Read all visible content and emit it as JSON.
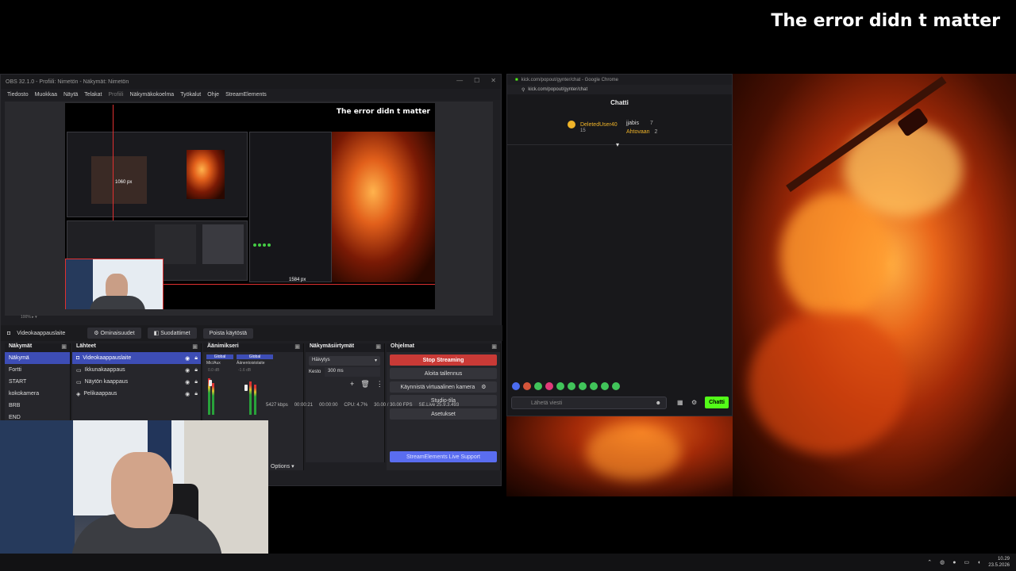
{
  "overlay": {
    "title": "The error didn t matter"
  },
  "obs": {
    "window_title": "OBS 32.1.0 - Profiili: Nimetön - Näkymät: Nimetön",
    "menu": [
      "Tiedosto",
      "Muokkaa",
      "Näytä",
      "Telakat",
      "Profiili",
      "Näkymäkokoelma",
      "Työkalut",
      "Ohje",
      "StreamElements"
    ],
    "preview_title": "The error didn t matter",
    "preview_px_label_1": "1060 px",
    "preview_px_label_2": "1584 px",
    "source_toolbar": {
      "current_source": "Videokaappauslaite",
      "properties": "Ominaisuudet",
      "filters": "Suodattimet",
      "deactivate": "Poista käytöstä"
    },
    "scenes": {
      "header": "Näkymät",
      "items": [
        "Näkymä",
        "Fortti",
        "START",
        "kokokamera",
        "BRB",
        "END"
      ]
    },
    "sources": {
      "header": "Lähteet",
      "items": [
        "Videokaappauslaite",
        "Ikkunakaappaus",
        "Näytön kaappaus",
        "Pelikaappaus"
      ]
    },
    "mixer": {
      "header": "Äänimikseri",
      "channels": [
        {
          "label": "Global",
          "name": "Mic/Aux",
          "db": "0.0 dB"
        },
        {
          "label": "Global",
          "name": "Äänentoistolaite",
          "db": "-1.6 dB"
        }
      ]
    },
    "transitions": {
      "header": "Näkymäsiirtymät",
      "type": "Häivytys",
      "duration_label": "Kesto",
      "duration": "300 ms"
    },
    "controls": {
      "header": "Ohjelmat",
      "stop_streaming": "Stop Streaming",
      "start_recording": "Aloita tallennus",
      "virtual_camera": "Käynnistä virtuaalinen kamera",
      "studio_mode": "Studio-tila",
      "settings": "Asetukset",
      "se_support": "StreamElements Live Support"
    },
    "options_label": "Options",
    "status": {
      "bitrate": "5427 kbps",
      "live_time": "00:00:21",
      "rec_time": "00:00:00",
      "cpu": "CPU: 4.7%",
      "fps": "30.00 / 30.00 FPS",
      "se_version": "SE.Live 25.9.3.493"
    }
  },
  "chat": {
    "window_title": "kick.com/popout/gynter/chat - Google Chrome",
    "url": "kick.com/popout/gynter/chat",
    "header": "Chatti",
    "leaders": [
      {
        "name": "DeletedUser40",
        "count": "15"
      },
      {
        "name": "jjabis",
        "count": "7"
      },
      {
        "name": "Ahtovaan",
        "count": "2"
      }
    ],
    "input_placeholder": "Lähetä viesti",
    "send_label": "Chatti",
    "colors": {
      "accent": "#53fc18"
    }
  },
  "taskbar": {
    "time": "10.29",
    "date": "23.5.2026"
  }
}
